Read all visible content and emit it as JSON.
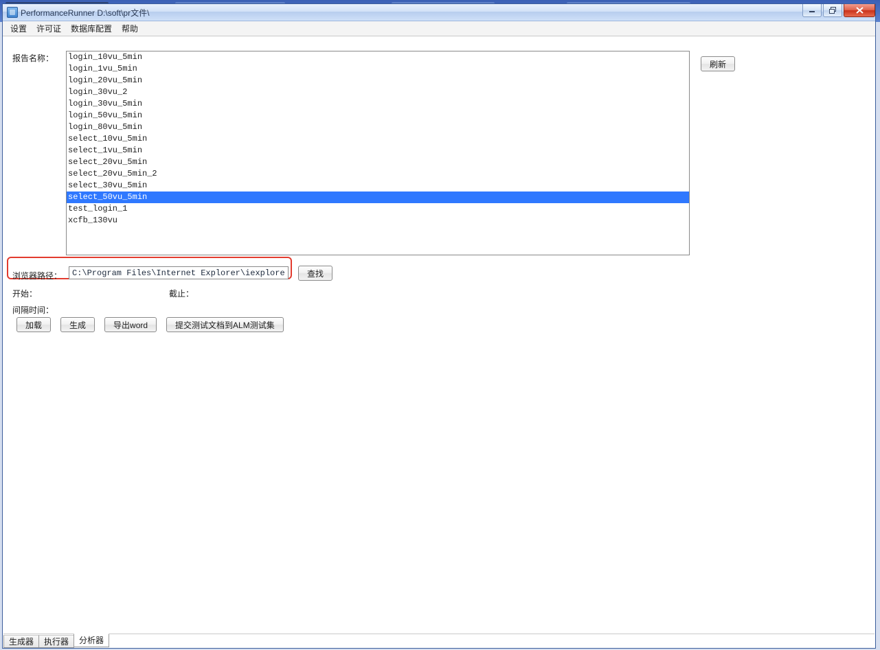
{
  "window": {
    "title": "PerformanceRunner  D:\\soft\\pr文件\\"
  },
  "menubar": {
    "items": [
      "设置",
      "许可证",
      "数据库配置",
      "帮助"
    ]
  },
  "labels": {
    "report_name": "报告名称：",
    "browser_path": "浏览器路径：",
    "start": "开始：",
    "stop": "截止：",
    "interval": "间隔时间："
  },
  "report_list": {
    "items": [
      "login_10vu_5min",
      "login_1vu_5min",
      "login_20vu_5min",
      "login_30vu_2",
      "login_30vu_5min",
      "login_50vu_5min",
      "login_80vu_5min",
      "select_10vu_5min",
      "select_1vu_5min",
      "select_20vu_5min",
      "select_20vu_5min_2",
      "select_30vu_5min",
      "select_50vu_5min",
      "test_login_1",
      "xcfb_130vu"
    ],
    "selected_index": 12
  },
  "browser_path": {
    "value": "C:\\Program Files\\Internet Explorer\\iexplore.exe"
  },
  "buttons": {
    "refresh": "刷新",
    "find": "查找",
    "load": "加载",
    "generate": "生成",
    "export_word": "导出word",
    "submit_alm": "提交测试文档到ALM测试集"
  },
  "bottom_tabs": {
    "items": [
      "生成器",
      "执行器",
      "分析器"
    ],
    "active_index": 2
  }
}
